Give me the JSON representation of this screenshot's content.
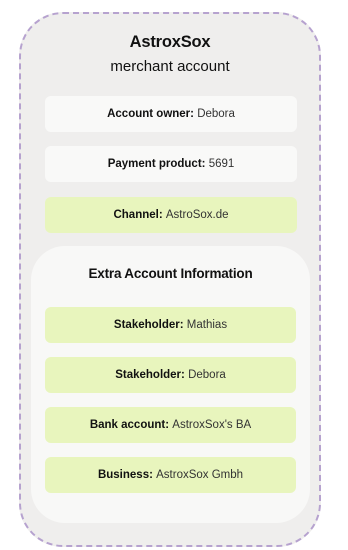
{
  "merchant": {
    "name": "AstroxSox",
    "subtitle": "merchant account",
    "fields": [
      {
        "key": "Account owner:",
        "value": "Debora",
        "style": "white"
      },
      {
        "key": "Payment product:",
        "value": "5691",
        "style": "white"
      },
      {
        "key": "Channel:",
        "value": "AstroSox.de",
        "style": "green"
      }
    ]
  },
  "extra": {
    "title": "Extra Account Information",
    "fields": [
      {
        "key": "Stakeholder:",
        "value": "Mathias",
        "style": "green"
      },
      {
        "key": "Stakeholder:",
        "value": "Debora",
        "style": "green"
      },
      {
        "key": "Bank account:",
        "value": "AstroxSox's BA",
        "style": "green"
      },
      {
        "key": "Business:",
        "value": "AstroxSox Gmbh",
        "style": "green"
      }
    ]
  },
  "colors": {
    "outer_background": "#efeeed",
    "dashed_border": "#b6a2cf",
    "inner_background": "#f8f8f7",
    "white_pill": "#f9f9f8",
    "green_pill": "#e8f5bd"
  }
}
